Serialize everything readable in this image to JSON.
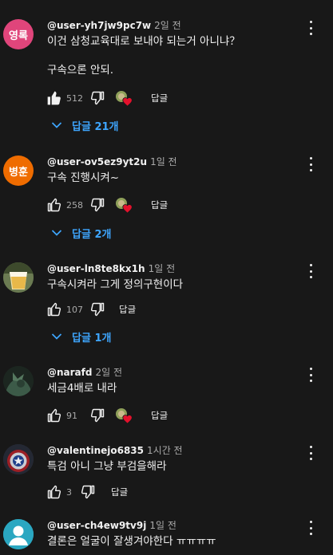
{
  "comments": [
    {
      "avatar_text": "영록",
      "author": "@user-yh7jw9pc7w",
      "time": "2일 전",
      "text": "이건 삼청교육대로 보내야 되는거 아니냐？\n\n구속으론 안되.",
      "likes": "512",
      "reply_label": "답글",
      "replies_label": "답글 21개"
    },
    {
      "avatar_text": "병훈",
      "author": "@user-ov5ez9yt2u",
      "time": "1일 전",
      "text": "구속  진행시켜~",
      "likes": "258",
      "reply_label": "답글",
      "replies_label": "답글 2개"
    },
    {
      "author": "@user-ln8te8kx1h",
      "time": "1일 전",
      "text": "구속시켜라 그게 정의구현이다",
      "likes": "107",
      "reply_label": "답글",
      "replies_label": "답글 1개"
    },
    {
      "author": "@narafd",
      "time": "2일 전",
      "text": "세금4배로 내라",
      "likes": "91",
      "reply_label": "답글"
    },
    {
      "author": "@valentinejo6835",
      "time": "1시간 전",
      "text": "특검 아니 그냥 부검을해라",
      "likes": "3",
      "reply_label": "답글"
    },
    {
      "author": "@user-ch4ew9tv9j",
      "time": "1일 전",
      "text": "결론은 얼굴이 잘생겨야한다 ㅠㅠㅠㅠ"
    }
  ],
  "colors": {
    "background": "#181818",
    "link": "#3ea6ff",
    "heart": "#e3112c",
    "text": "#f1f1f1",
    "muted": "#aaaaaa"
  },
  "icons": {
    "like": "thumbs-up-icon",
    "dislike": "thumbs-down-icon",
    "creator_heart": "creator-heart-icon",
    "more": "kebab-menu-icon",
    "expand": "chevron-down-icon"
  }
}
